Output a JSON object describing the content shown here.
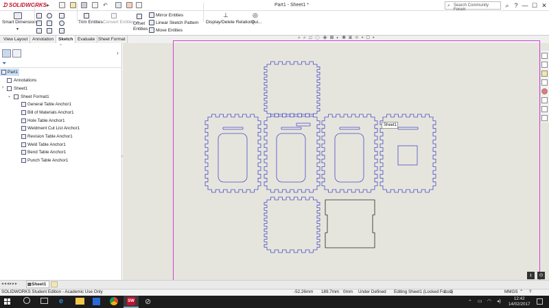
{
  "titlebar": {
    "logo": "SOLIDWORKS",
    "doc_title": "Part1 - Sheet1 *",
    "search_placeholder": "Search Community Forum",
    "help": "?",
    "minimize": "—",
    "maximize": "☐",
    "close": "✕"
  },
  "commands": {
    "smart_dimension": "Smart Dimension",
    "trim": "Trim Entities",
    "convert": "Convert Entities",
    "offset": "Offset Entities",
    "mirror": "Mirror Entities",
    "linear_pattern": "Linear Sketch Pattern",
    "move": "Move Entities",
    "display_relations": "Display/Delete Relations",
    "quick_snaps": "Qui..."
  },
  "tabs": [
    "View Layout",
    "Annotation",
    "Sketch",
    "Evaluate",
    "Sheet Format"
  ],
  "active_tab": "Sketch",
  "tree": {
    "root": "Part1",
    "annotations": "Annotations",
    "sheet": "Sheet1",
    "sheet_format": "Sheet Format1",
    "anchors": [
      "General Table Anchor1",
      "Bill of Materials Anchor1",
      "Hole Table Anchor1",
      "Weldment Cut List Anchor1",
      "Revision Table Anchor1",
      "Weld Table Anchor1",
      "Bend Table Anchor1",
      "Punch Table Anchor1"
    ]
  },
  "graphics": {
    "tooltip": "Sheet1",
    "background": "#e5e5dd",
    "sketch_color": "#4a4ac8",
    "sheet_border_color": "#d040d0"
  },
  "sheet_tab": "Sheet1",
  "status": {
    "edition": "SOLIDWORKS Student Edition - Academic Use Only",
    "x": "-52.26mm",
    "y": "189.7mm",
    "z": "0mm",
    "state": "Under Defined",
    "editing": "Editing Sheet1 (Locked Focus)",
    "scale": "1 : 2",
    "units": "MMGS"
  },
  "clock": {
    "time": "12:42",
    "date": "14/02/2017"
  }
}
